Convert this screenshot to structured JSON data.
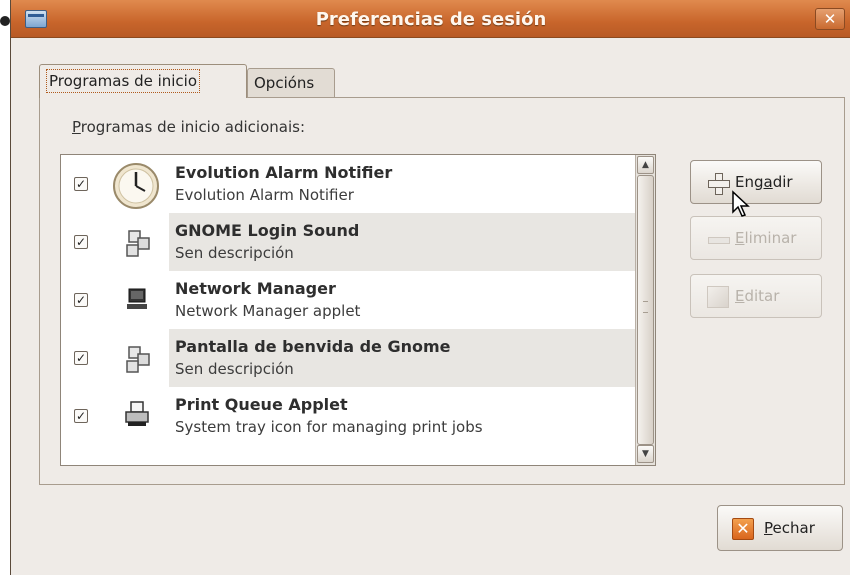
{
  "window": {
    "title": "Preferencias de sesión"
  },
  "tabs": [
    {
      "label": "Programas de inicio",
      "active": true
    },
    {
      "label": "Opcións",
      "active": false
    }
  ],
  "section": {
    "prefix": "P",
    "label_rest": "rogramas de inicio adicionais:"
  },
  "programs": [
    {
      "name": "Evolution Alarm Notifier",
      "desc": "Evolution Alarm Notifier",
      "checked": true,
      "icon": "clock-icon"
    },
    {
      "name": "GNOME Login Sound",
      "desc": "Sen descripción",
      "checked": true,
      "icon": "gears-icon"
    },
    {
      "name": "Network Manager",
      "desc": "Network Manager applet",
      "checked": true,
      "icon": "computer-icon"
    },
    {
      "name": "Pantalla de benvida de Gnome",
      "desc": "Sen descripción",
      "checked": true,
      "icon": "gears-icon"
    },
    {
      "name": "Print Queue Applet",
      "desc": "System tray icon for managing print jobs",
      "checked": true,
      "icon": "printer-icon"
    }
  ],
  "buttons": {
    "add": {
      "pre": "Eng",
      "mnemonic": "a",
      "post": "dir"
    },
    "remove": {
      "pre": "",
      "mnemonic": "E",
      "post": "liminar"
    },
    "edit": {
      "pre": "",
      "mnemonic": "E",
      "post": "ditar"
    },
    "close": {
      "pre": "",
      "mnemonic": "P",
      "post": "echar"
    }
  },
  "colors": {
    "titlebar": "#c8652b",
    "window_bg": "#efebe7",
    "shaded_row": "#e8e6e2"
  }
}
